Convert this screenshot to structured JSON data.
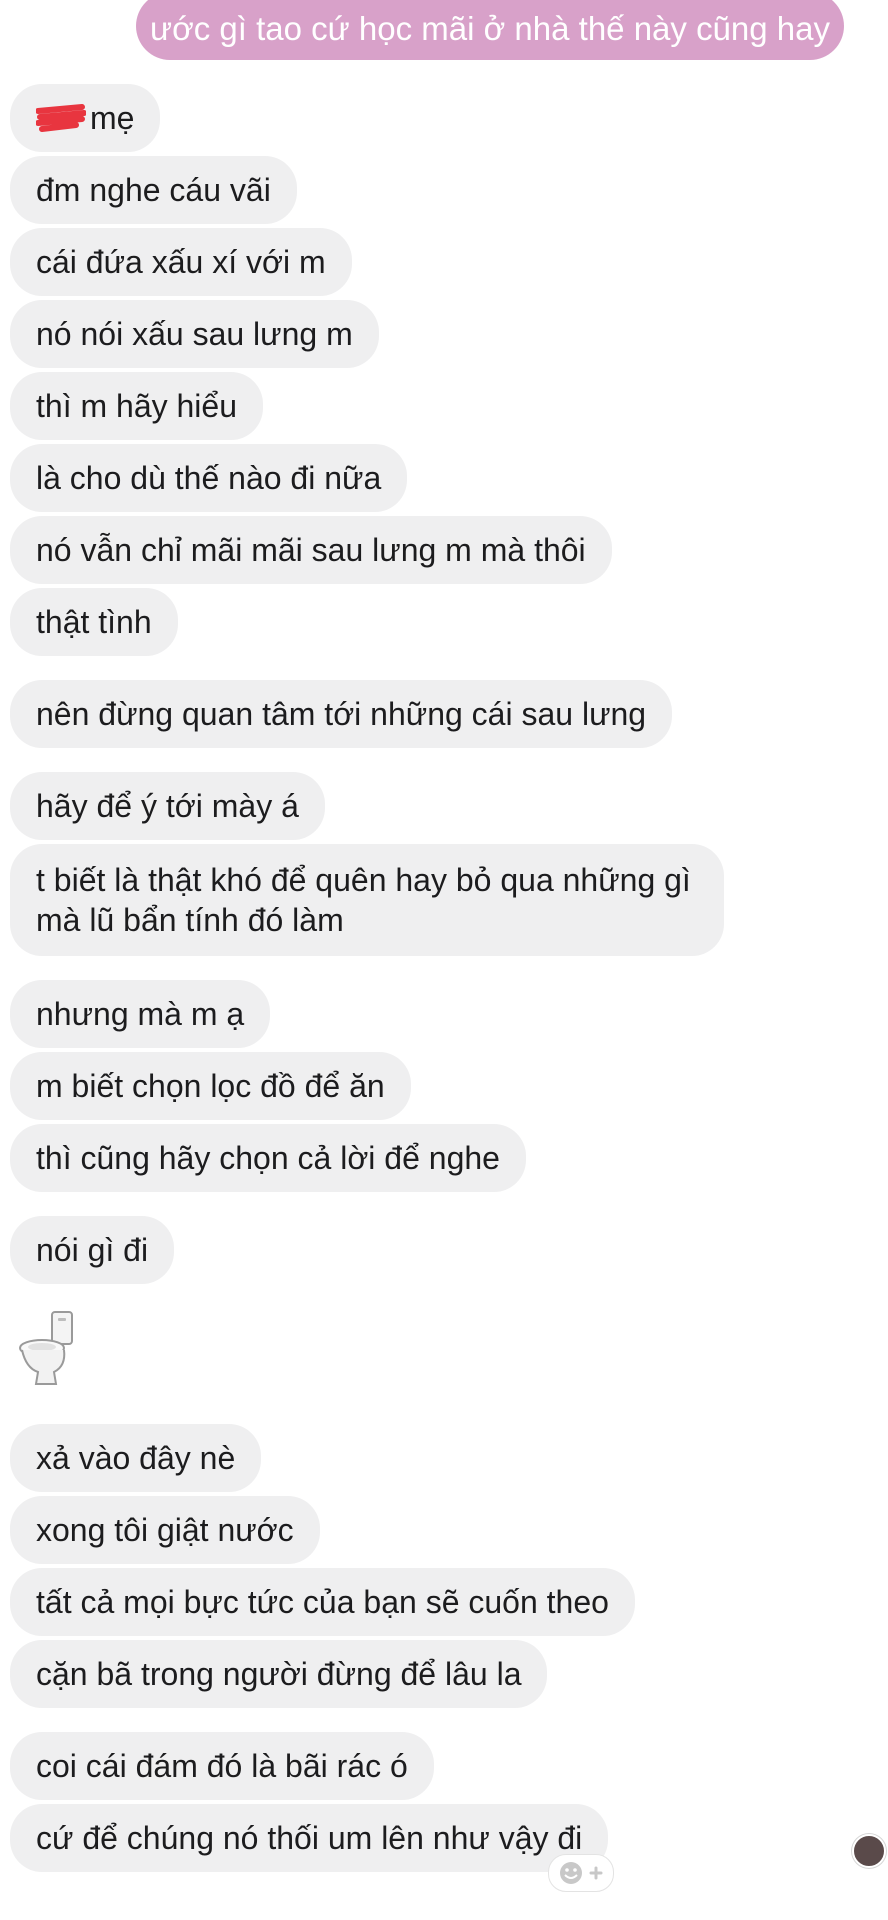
{
  "sent_message": "ước gì tao cứ học mãi ở nhà thế này cũng hay",
  "received": {
    "m0": "mẹ",
    "m1": "đm nghe cáu vãi",
    "m2": "cái đứa xấu xí với m",
    "m3": "nó nói xấu sau lưng m",
    "m4": "thì m hãy hiểu",
    "m5": "là cho dù thế nào đi nữa",
    "m6": "nó vẫn chỉ mãi mãi sau lưng m mà thôi",
    "m7": "thật tình",
    "m8": "nên đừng quan tâm tới những cái sau lưng",
    "m9": "hãy để ý tới mày á",
    "m10": "t biết là thật khó để quên hay bỏ qua những gì mà lũ bẩn tính đó làm",
    "m11": "nhưng mà m ạ",
    "m12": "m biết chọn lọc đồ để ăn",
    "m13": "thì cũng hãy chọn cả lời để nghe",
    "m14": "nói gì đi",
    "m15": "xả vào đây nè",
    "m16": "xong tôi giật nước",
    "m17": "tất cả mọi bực tức của bạn sẽ cuốn theo",
    "m18": "cặn bã trong người đừng để lâu la",
    "m19": "coi cái đám đó là bãi rác ó",
    "m20": "cứ để chúng nó thối um lên như vậy đi"
  },
  "sticker": "toilet-icon",
  "colors": {
    "sent_bubble": "#d8a1c9",
    "received_bubble": "#efeff0",
    "redaction": "#e8353f"
  }
}
